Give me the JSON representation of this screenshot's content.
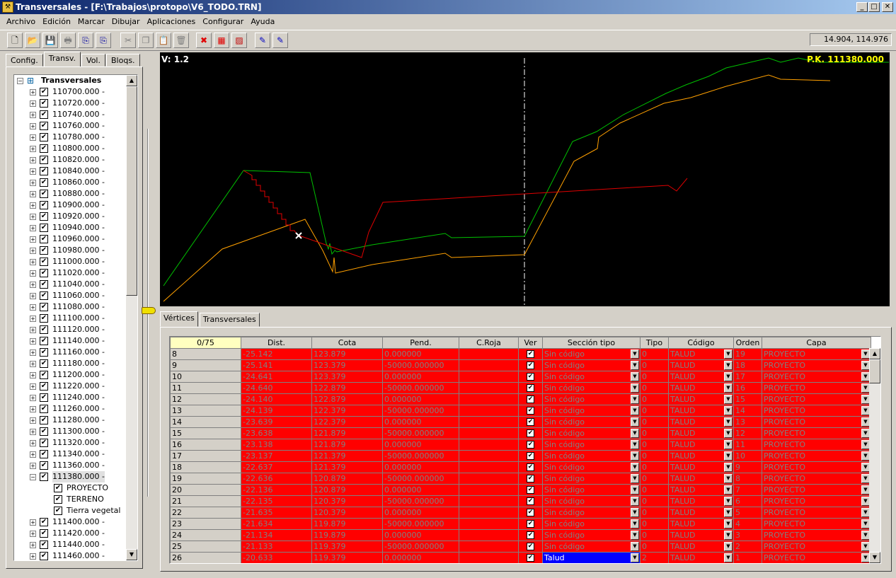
{
  "window": {
    "title": "Transversales - [F:\\Trabajos\\protopo\\V6_TODO.TRN]",
    "minimize": "_",
    "maximize": "□",
    "close": "✕"
  },
  "menu": [
    "Archivo",
    "Edición",
    "Marcar",
    "Dibujar",
    "Aplicaciones",
    "Configurar",
    "Ayuda"
  ],
  "toolbar": {
    "coordinates": "14.904, 114.976",
    "buttons": [
      "new-file-icon",
      "open-folder-icon",
      "save-icon",
      "print-icon",
      "export-icon",
      "export2-icon",
      "cut-icon",
      "copy-icon",
      "paste-icon",
      "delete-icon",
      "cross-section-icon",
      "table-icon",
      "hatch-icon",
      "doc-edit-icon",
      "doc-edit2-icon"
    ]
  },
  "left_tabs": [
    "Config.",
    "Transv.",
    "Vol.",
    "Bloqs."
  ],
  "tree": {
    "root": "Transversales",
    "items": [
      "110700.000 -",
      "110720.000 -",
      "110740.000 -",
      "110760.000 -",
      "110780.000 -",
      "110800.000 -",
      "110820.000 -",
      "110840.000 -",
      "110860.000 -",
      "110880.000 -",
      "110900.000 -",
      "110920.000 -",
      "110940.000 -",
      "110960.000 -",
      "110980.000 -",
      "111000.000 -",
      "111020.000 -",
      "111040.000 -",
      "111060.000 -",
      "111080.000 -",
      "111100.000 -",
      "111120.000 -",
      "111140.000 -",
      "111160.000 -",
      "111180.000 -",
      "111200.000 -",
      "111220.000 -",
      "111240.000 -",
      "111260.000 -",
      "111280.000 -",
      "111300.000 -",
      "111320.000 -",
      "111340.000 -",
      "111360.000 -",
      "111380.000 -"
    ],
    "expanded_children": [
      "PROYECTO",
      "TERRENO",
      "Tierra vegetal"
    ],
    "items_after": [
      "111400.000 -",
      "111420.000 -",
      "111440.000 -",
      "111460.000 -"
    ]
  },
  "canvas": {
    "version": "V: 1.2",
    "pk": "P.K. 111380.000",
    "colors": {
      "green": "#00c000",
      "orange": "#ffa000",
      "red": "#e00000",
      "bg": "#000000"
    }
  },
  "bottom_tabs": [
    "Vértices",
    "Transversales"
  ],
  "grid": {
    "corner": "0/75",
    "headers": [
      "Dist.",
      "Cota",
      "Pend.",
      "C.Roja",
      "Ver",
      "Sección tipo",
      "Tipo",
      "Código",
      "Orden",
      "Capa"
    ],
    "rows": [
      {
        "n": "8",
        "dist": "-25.142",
        "cota": "123.879",
        "pend": "0.000000",
        "sec": "Sin código",
        "tipo": "0",
        "cod": "TALUD",
        "ord": "19",
        "capa": "PROYECTO"
      },
      {
        "n": "9",
        "dist": "-25.141",
        "cota": "123.379",
        "pend": "-50000.000000",
        "sec": "Sin código",
        "tipo": "0",
        "cod": "TALUD",
        "ord": "18",
        "capa": "PROYECTO"
      },
      {
        "n": "10",
        "dist": "-24.641",
        "cota": "123.379",
        "pend": "0.000000",
        "sec": "Sin código",
        "tipo": "0",
        "cod": "TALUD",
        "ord": "17",
        "capa": "PROYECTO"
      },
      {
        "n": "11",
        "dist": "-24.640",
        "cota": "122.879",
        "pend": "-50000.000000",
        "sec": "Sin código",
        "tipo": "0",
        "cod": "TALUD",
        "ord": "16",
        "capa": "PROYECTO"
      },
      {
        "n": "12",
        "dist": "-24.140",
        "cota": "122.879",
        "pend": "0.000000",
        "sec": "Sin código",
        "tipo": "0",
        "cod": "TALUD",
        "ord": "15",
        "capa": "PROYECTO"
      },
      {
        "n": "13",
        "dist": "-24.139",
        "cota": "122.379",
        "pend": "-50000.000000",
        "sec": "Sin código",
        "tipo": "0",
        "cod": "TALUD",
        "ord": "14",
        "capa": "PROYECTO"
      },
      {
        "n": "14",
        "dist": "-23.639",
        "cota": "122.379",
        "pend": "0.000000",
        "sec": "Sin código",
        "tipo": "0",
        "cod": "TALUD",
        "ord": "13",
        "capa": "PROYECTO"
      },
      {
        "n": "15",
        "dist": "-23.638",
        "cota": "121.879",
        "pend": "-50000.000000",
        "sec": "Sin código",
        "tipo": "0",
        "cod": "TALUD",
        "ord": "12",
        "capa": "PROYECTO"
      },
      {
        "n": "16",
        "dist": "-23.138",
        "cota": "121.879",
        "pend": "0.000000",
        "sec": "Sin código",
        "tipo": "0",
        "cod": "TALUD",
        "ord": "11",
        "capa": "PROYECTO"
      },
      {
        "n": "17",
        "dist": "-23.137",
        "cota": "121.379",
        "pend": "-50000.000000",
        "sec": "Sin código",
        "tipo": "0",
        "cod": "TALUD",
        "ord": "10",
        "capa": "PROYECTO"
      },
      {
        "n": "18",
        "dist": "-22.637",
        "cota": "121.379",
        "pend": "0.000000",
        "sec": "Sin código",
        "tipo": "0",
        "cod": "TALUD",
        "ord": "9",
        "capa": "PROYECTO"
      },
      {
        "n": "19",
        "dist": "-22.636",
        "cota": "120.879",
        "pend": "-50000.000000",
        "sec": "Sin código",
        "tipo": "0",
        "cod": "TALUD",
        "ord": "8",
        "capa": "PROYECTO"
      },
      {
        "n": "20",
        "dist": "-22.136",
        "cota": "120.879",
        "pend": "0.000000",
        "sec": "Sin código",
        "tipo": "0",
        "cod": "TALUD",
        "ord": "7",
        "capa": "PROYECTO"
      },
      {
        "n": "21",
        "dist": "-22.135",
        "cota": "120.379",
        "pend": "-50000.000000",
        "sec": "Sin código",
        "tipo": "0",
        "cod": "TALUD",
        "ord": "6",
        "capa": "PROYECTO"
      },
      {
        "n": "22",
        "dist": "-21.635",
        "cota": "120.379",
        "pend": "0.000000",
        "sec": "Sin código",
        "tipo": "0",
        "cod": "TALUD",
        "ord": "5",
        "capa": "PROYECTO"
      },
      {
        "n": "23",
        "dist": "-21.634",
        "cota": "119.879",
        "pend": "-50000.000000",
        "sec": "Sin código",
        "tipo": "0",
        "cod": "TALUD",
        "ord": "4",
        "capa": "PROYECTO"
      },
      {
        "n": "24",
        "dist": "-21.134",
        "cota": "119.879",
        "pend": "0.000000",
        "sec": "Sin código",
        "tipo": "0",
        "cod": "TALUD",
        "ord": "3",
        "capa": "PROYECTO"
      },
      {
        "n": "25",
        "dist": "-21.133",
        "cota": "119.379",
        "pend": "-50000.000000",
        "sec": "Sin código",
        "tipo": "0",
        "cod": "TALUD",
        "ord": "2",
        "capa": "PROYECTO"
      },
      {
        "n": "26",
        "dist": "-20.633",
        "cota": "119.379",
        "pend": "0.000000",
        "sec": "Talud",
        "tipo": "2",
        "cod": "TALUD",
        "ord": "1",
        "capa": "PROYECTO"
      }
    ]
  }
}
